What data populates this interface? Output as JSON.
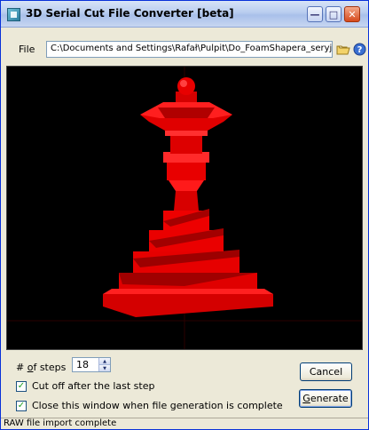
{
  "window": {
    "title": "3D Serial Cut File Converter  [beta]",
    "accent": "#0831d9"
  },
  "title_controls": {
    "minimize_icon": "minimize-icon",
    "maximize_icon": "maximize-icon",
    "close_icon": "close-icon"
  },
  "file": {
    "label": "File",
    "path": "C:\\Documents and Settings\\Rafał\\Pulpit\\Do_FoamShapera_seryjne\\Kapliczka.raw",
    "open_icon": "folder-open-icon",
    "help_icon": "help-icon"
  },
  "preview": {
    "background": "#000000",
    "model_color": "#ee0000"
  },
  "steps": {
    "label_prefix": "#",
    "label_underlined": "o",
    "label_rest": "f steps",
    "value": "18"
  },
  "options": {
    "cut_off_label": "Cut off after the last step",
    "cut_off_checked": true,
    "close_window_label": "Close this window when file generation is complete",
    "close_window_checked": true
  },
  "buttons": {
    "cancel": "Cancel",
    "generate_underlined": "G",
    "generate_rest": "enerate"
  },
  "status": {
    "text": "RAW file import complete"
  }
}
